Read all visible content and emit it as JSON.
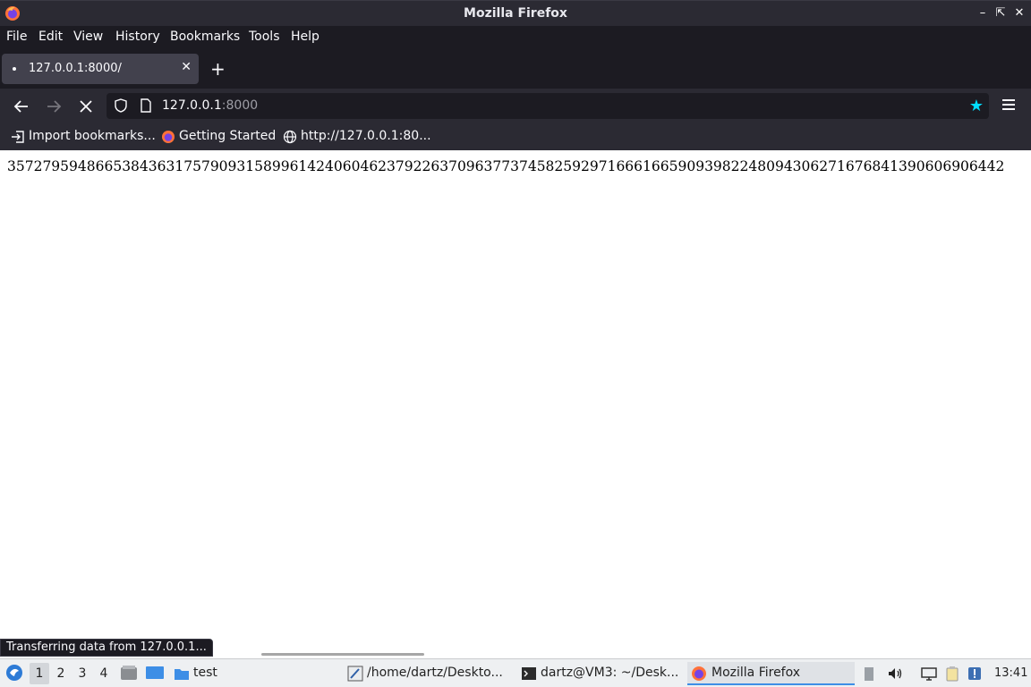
{
  "window": {
    "title": "Mozilla Firefox"
  },
  "menu": [
    "File",
    "Edit",
    "View",
    "History",
    "Bookmarks",
    "Tools",
    "Help"
  ],
  "tab": {
    "title": "127.0.0.1:8000/"
  },
  "urlbar": {
    "host": "127.0.0.1",
    "port": ":8000"
  },
  "bookmarks": [
    "Import bookmarks...",
    "Getting Started",
    "http://127.0.0.1:80..."
  ],
  "page": {
    "digits": "35727959486653843631757909315899614240604623792263709637737458259297166616659093982248094306271676841390606906442"
  },
  "status": "Transferring data from 127.0.0.1...",
  "taskbar": {
    "workspaces": [
      "1",
      "2",
      "3",
      "4"
    ],
    "folder_label": "test",
    "tasks": [
      "/home/dartz/Deskto...",
      "dartz@VM3: ~/Desk...",
      "Mozilla Firefox"
    ],
    "clock": "13:41"
  },
  "colors": {
    "accent": "#00ddff",
    "chrome_dark": "#1c1b22",
    "chrome": "#2b2a33",
    "taskbar": "#eef0f2"
  }
}
